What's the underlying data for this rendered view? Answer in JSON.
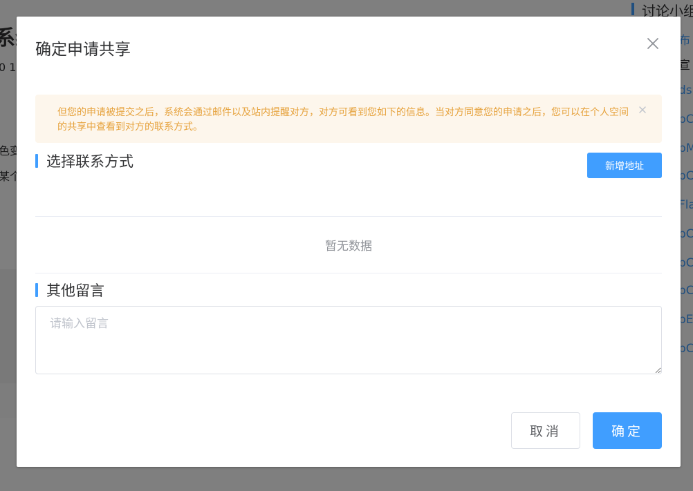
{
  "background": {
    "left_title_fragment": "系统",
    "left_sub_fragment": "0 1",
    "left_line1_fragment": "色变",
    "left_line2_fragment": "某个",
    "right_panel_title": "讨论小组",
    "right_items": [
      {
        "text": "布",
        "style": "link"
      },
      {
        "text": "宣",
        "style": "dark"
      },
      {
        "text": "ds",
        "style": "link"
      },
      {
        "text": "pC",
        "style": "link"
      },
      {
        "text": "pM",
        "style": "link"
      },
      {
        "text": "pC",
        "style": "link"
      },
      {
        "text": "Fla",
        "style": "link"
      },
      {
        "text": "pC",
        "style": "link"
      },
      {
        "text": "pC",
        "style": "link"
      },
      {
        "text": "pC",
        "style": "link"
      },
      {
        "text": "pE",
        "style": "link"
      },
      {
        "text": "pC",
        "style": "link"
      }
    ]
  },
  "dialog": {
    "title": "确定申请共享",
    "close_icon": "close-icon",
    "alert": {
      "text": "但您的申请被提交之后，系统会通过邮件以及站内提醒对方，对方可看到您如下的信息。当对方同意您的申请之后，您可以在个人空间的共享中查看到对方的联系方式。",
      "close_icon": "close-icon"
    },
    "contact_section": {
      "title": "选择联系方式",
      "add_button_label": "新增地址",
      "empty_text": "暂无数据"
    },
    "message_section": {
      "title": "其他留言",
      "placeholder": "请输入留言",
      "value": ""
    },
    "footer": {
      "cancel_label": "取消",
      "confirm_label": "确定"
    }
  },
  "colors": {
    "primary": "#409eff",
    "warning_text": "#e6a23c",
    "warning_bg": "#fdf6ec",
    "overlay": "rgba(0,0,0,0.5)"
  }
}
